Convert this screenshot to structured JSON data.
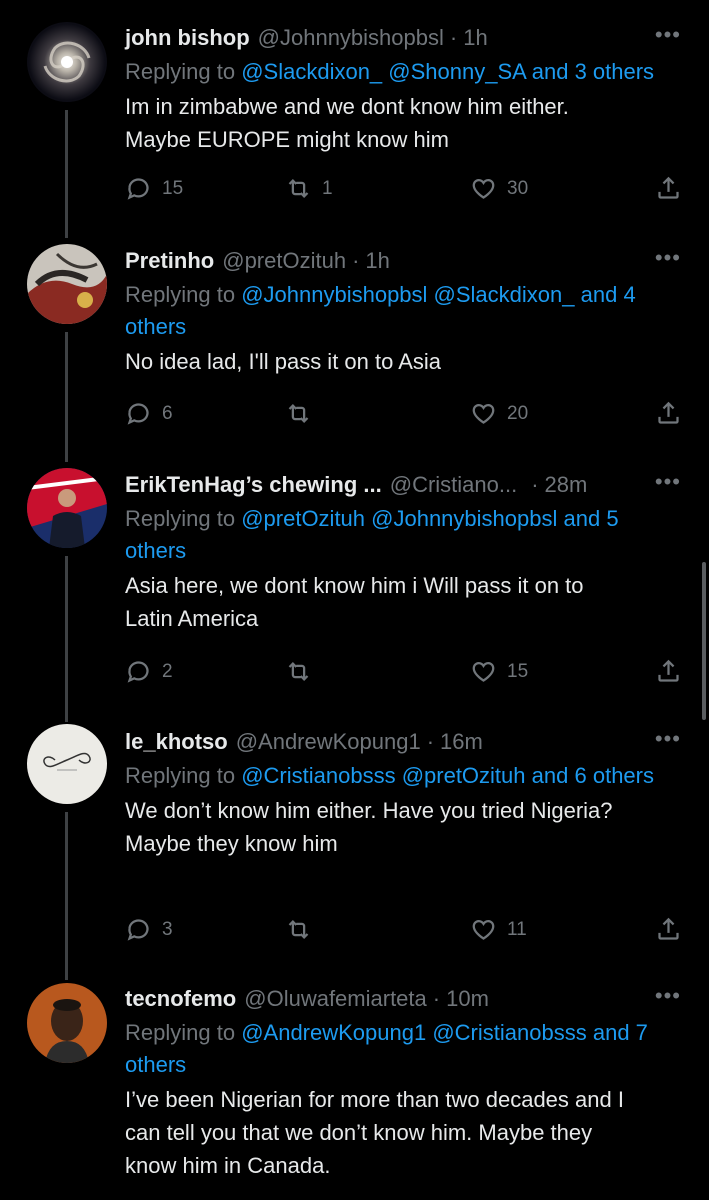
{
  "tweets": [
    {
      "name": "john bishop",
      "handle": "@Johnnybishopbsl",
      "time": "1h",
      "reply_prefix": "Replying to",
      "reply_mentions": "@Slackdixon_ @Shonny_SA",
      "reply_and": "and",
      "reply_others": "3 others",
      "text_lines": [
        "Im in zimbabwe and we dont know  him either.",
        "Maybe EUROPE might know him"
      ],
      "replies": "15",
      "retweets": "1",
      "likes": "30",
      "avatar_icon": "galaxy-icon"
    },
    {
      "name": "Pretinho",
      "handle": "@pretOzituh",
      "time": "1h",
      "reply_prefix": "Replying to",
      "reply_mentions": "@Johnnybishopbsl @Slackdixon_",
      "reply_and": "and 4",
      "reply_others": "others",
      "text_lines": [
        "No idea lad, I'll pass it on to Asia"
      ],
      "replies": "6",
      "retweets": "",
      "likes": "20",
      "avatar_icon": "photo-icon"
    },
    {
      "name": "ErikTenHag’s chewing ...",
      "handle": "@Cristiano...",
      "time": "28m",
      "reply_prefix": "Replying to",
      "reply_mentions": "@pretOzituh @Johnnybishopbsl",
      "reply_and": "and 5",
      "reply_others": "others",
      "text_lines": [
        "Asia here, we dont know him i Will pass it on to",
        "Latin America"
      ],
      "replies": "2",
      "retweets": "",
      "likes": "15",
      "avatar_icon": "person-icon"
    },
    {
      "name": "le_khotso",
      "handle": "@AndrewKopung1",
      "time": "16m",
      "reply_prefix": "Replying to",
      "reply_mentions": "@Cristianobsss @pretOzituh",
      "reply_and": "and 6",
      "reply_others": "others",
      "text_lines": [
        "We don’t know him either. Have you tried Nigeria?",
        "Maybe they know him"
      ],
      "replies": "3",
      "retweets": "",
      "likes": "11",
      "avatar_icon": "infinity-icon"
    },
    {
      "name": "tecnofemo",
      "handle": "@Oluwafemiarteta",
      "time": "10m",
      "reply_prefix": "Replying to",
      "reply_mentions": "@AndrewKopung1 @Cristianobsss",
      "reply_and": "and 7",
      "reply_others": "others",
      "text_lines": [
        "I’ve been Nigerian for more than two decades and I",
        "can tell you that we don’t know him. Maybe they",
        "know him in Canada."
      ],
      "avatar_icon": "face-icon"
    }
  ],
  "ui": {
    "separator": "·",
    "more": "•••"
  },
  "colors": {
    "background": "#000000",
    "text": "#e7e9ea",
    "muted": "#71767b",
    "link": "#1d9bf0",
    "thread_line": "#3e4144"
  }
}
